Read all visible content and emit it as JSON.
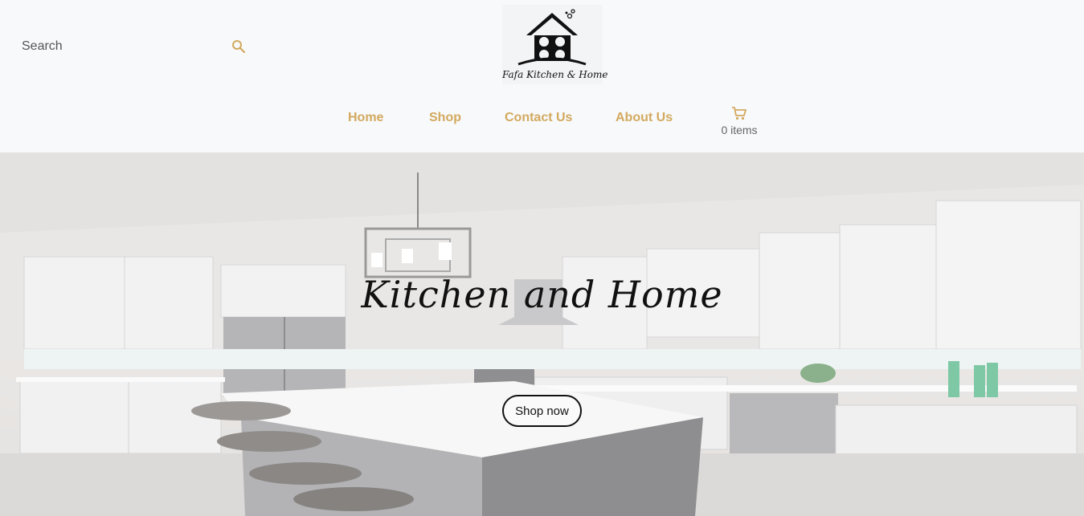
{
  "search": {
    "placeholder": "Search"
  },
  "logo": {
    "text": "Fafa Kitchen & Home"
  },
  "nav": {
    "items": [
      {
        "label": "Home"
      },
      {
        "label": "Shop"
      },
      {
        "label": "Contact Us"
      },
      {
        "label": "About Us"
      }
    ],
    "cart": {
      "count_text": "0 items"
    }
  },
  "hero": {
    "title": "Kitchen and Home",
    "button_label": "Shop now"
  },
  "colors": {
    "accent": "#d3a95e",
    "background": "#f7f9fb",
    "text": "#111111"
  },
  "icons": [
    "search-icon",
    "cart-icon",
    "house-logo-icon"
  ]
}
